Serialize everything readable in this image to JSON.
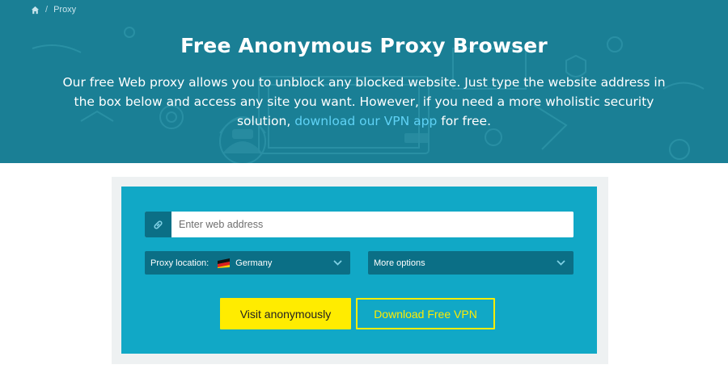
{
  "breadcrumb": {
    "home_icon": "home-icon",
    "separator": "/",
    "current": "Proxy"
  },
  "hero": {
    "title": "Free Anonymous Proxy Browser",
    "desc_before": "Our free Web proxy allows you to unblock any blocked website. Just type the website address in the box below and access any site you want. However, if you need a more wholistic security solution, ",
    "desc_link": "download our VPN app",
    "desc_after": " for free."
  },
  "form": {
    "link_icon": "link-icon",
    "url_placeholder": "Enter web address",
    "proxy_location_label": "Proxy location:",
    "proxy_location_value": "Germany",
    "proxy_location_flag": "germany-flag-icon",
    "more_options_label": "More options",
    "visit_button": "Visit anonymously",
    "download_button": "Download Free VPN"
  },
  "colors": {
    "hero_bg": "#1a7f95",
    "panel_bg": "#11a8c6",
    "dark_field": "#0b6f86",
    "accent_yellow": "#ffec00",
    "link_blue": "#5fd2f5"
  }
}
